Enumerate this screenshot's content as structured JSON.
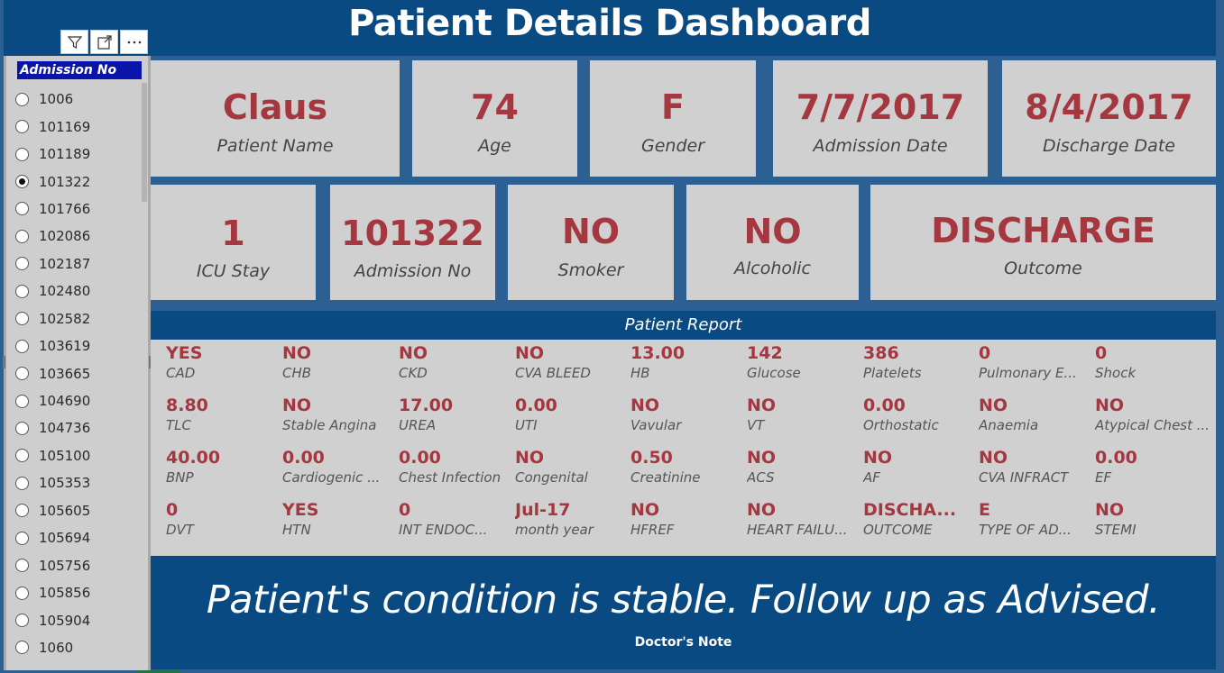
{
  "dashboard": {
    "title": "Patient Details Dashboard"
  },
  "colors": {
    "title_bg": "#0a4a82",
    "value_text": "#a4373f",
    "card_bg": "#d0d0d0",
    "slicer_header_bg": "#0b14a8"
  },
  "toolbar": {
    "icons": [
      "filter-icon",
      "focus-mode-icon",
      "more-options-icon"
    ]
  },
  "slicer": {
    "header": "Admission No",
    "selected": "101322",
    "items": [
      {
        "label": "1006"
      },
      {
        "label": "101169"
      },
      {
        "label": "101189"
      },
      {
        "label": "101322"
      },
      {
        "label": "101766"
      },
      {
        "label": "102086"
      },
      {
        "label": "102187"
      },
      {
        "label": "102480"
      },
      {
        "label": "102582"
      },
      {
        "label": "103619"
      },
      {
        "label": "103665"
      },
      {
        "label": "104690"
      },
      {
        "label": "104736"
      },
      {
        "label": "105100"
      },
      {
        "label": "105353"
      },
      {
        "label": "105605"
      },
      {
        "label": "105694"
      },
      {
        "label": "105756"
      },
      {
        "label": "105856"
      },
      {
        "label": "105904"
      },
      {
        "label": "1060"
      }
    ]
  },
  "cards_row1": [
    {
      "value": "Claus",
      "label": "Patient Name"
    },
    {
      "value": "74",
      "label": "Age"
    },
    {
      "value": "F",
      "label": "Gender"
    },
    {
      "value": "7/7/2017",
      "label": "Admission Date"
    },
    {
      "value": "8/4/2017",
      "label": "Discharge Date"
    }
  ],
  "cards_row2": [
    {
      "value": "1",
      "label": "ICU Stay"
    },
    {
      "value": "101322",
      "label": "Admission No"
    },
    {
      "value": "NO",
      "label": "Smoker"
    },
    {
      "value": "NO",
      "label": "Alcoholic"
    },
    {
      "value": "DISCHARGE",
      "label": "Outcome"
    }
  ],
  "report": {
    "title": "Patient Report",
    "rows": [
      [
        {
          "value": "YES",
          "label": "CAD"
        },
        {
          "value": "NO",
          "label": "CHB"
        },
        {
          "value": "NO",
          "label": "CKD"
        },
        {
          "value": "NO",
          "label": "CVA BLEED"
        },
        {
          "value": "13.00",
          "label": "HB"
        },
        {
          "value": "142",
          "label": "Glucose"
        },
        {
          "value": "386",
          "label": "Platelets"
        },
        {
          "value": "0",
          "label": "Pulmonary E..."
        },
        {
          "value": "0",
          "label": "Shock"
        }
      ],
      [
        {
          "value": "8.80",
          "label": "TLC"
        },
        {
          "value": "NO",
          "label": "Stable Angina"
        },
        {
          "value": "17.00",
          "label": "UREA"
        },
        {
          "value": "0.00",
          "label": "UTI"
        },
        {
          "value": "NO",
          "label": "Vavular"
        },
        {
          "value": "NO",
          "label": "VT"
        },
        {
          "value": "0.00",
          "label": "Orthostatic"
        },
        {
          "value": "NO",
          "label": "Anaemia"
        },
        {
          "value": "NO",
          "label": "Atypical Chest ..."
        }
      ],
      [
        {
          "value": "40.00",
          "label": "BNP"
        },
        {
          "value": "0.00",
          "label": "Cardiogenic ..."
        },
        {
          "value": "0.00",
          "label": "Chest Infection"
        },
        {
          "value": "NO",
          "label": "Congenital"
        },
        {
          "value": "0.50",
          "label": "Creatinine"
        },
        {
          "value": "NO",
          "label": "ACS"
        },
        {
          "value": "NO",
          "label": "AF"
        },
        {
          "value": "NO",
          "label": "CVA INFRACT"
        },
        {
          "value": "0.00",
          "label": "EF"
        }
      ],
      [
        {
          "value": "0",
          "label": "DVT"
        },
        {
          "value": "YES",
          "label": "HTN"
        },
        {
          "value": "0",
          "label": "INT ENDOC..."
        },
        {
          "value": "Jul-17",
          "label": "month year"
        },
        {
          "value": "NO",
          "label": "HFREF"
        },
        {
          "value": "NO",
          "label": "HEART FAILU..."
        },
        {
          "value": "DISCHA...",
          "label": "OUTCOME"
        },
        {
          "value": "E",
          "label": "TYPE OF AD..."
        },
        {
          "value": "NO",
          "label": "STEMI"
        }
      ]
    ]
  },
  "doctor_note": {
    "text": "Patient's condition is stable. Follow up as Advised.",
    "label": "Doctor's Note"
  }
}
